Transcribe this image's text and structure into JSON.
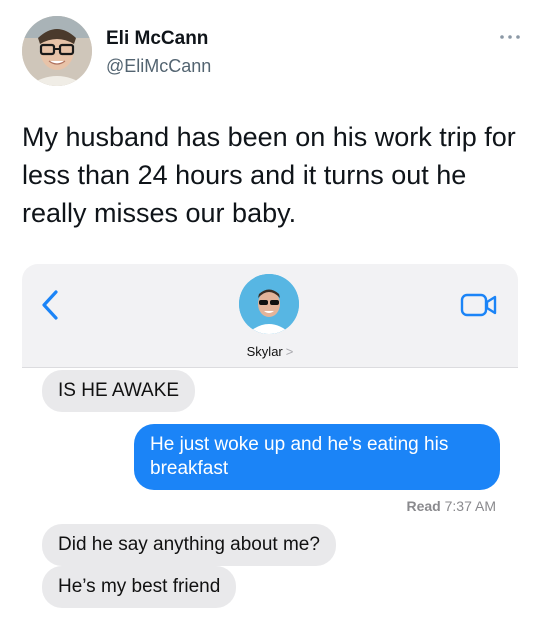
{
  "tweet": {
    "author_name": "Eli McCann",
    "author_handle": "@EliMcCann",
    "text": "My husband has been on his work trip for less than 24 hours and it turns out he really misses our baby."
  },
  "conversation": {
    "contact_name": "Skylar",
    "contact_chevron": ">",
    "messages": [
      {
        "direction": "incoming",
        "text": "IS HE AWAKE"
      },
      {
        "direction": "outgoing",
        "text": "He just woke up and he's eating his breakfast"
      },
      {
        "direction": "incoming",
        "text": "Did he say anything about me?"
      },
      {
        "direction": "incoming",
        "text": "He’s my best friend"
      }
    ],
    "read_receipt": {
      "label": "Read",
      "time": "7:37 AM"
    }
  },
  "icons": {
    "more": "more-dots-icon",
    "back": "chevron-left-icon",
    "video": "video-camera-icon"
  },
  "colors": {
    "tweet_text": "#0f1419",
    "handle_gray": "#536471",
    "imessage_blue": "#1b84f7",
    "incoming_bubble": "#e9e9eb",
    "header_bg": "#f2f2f4"
  }
}
